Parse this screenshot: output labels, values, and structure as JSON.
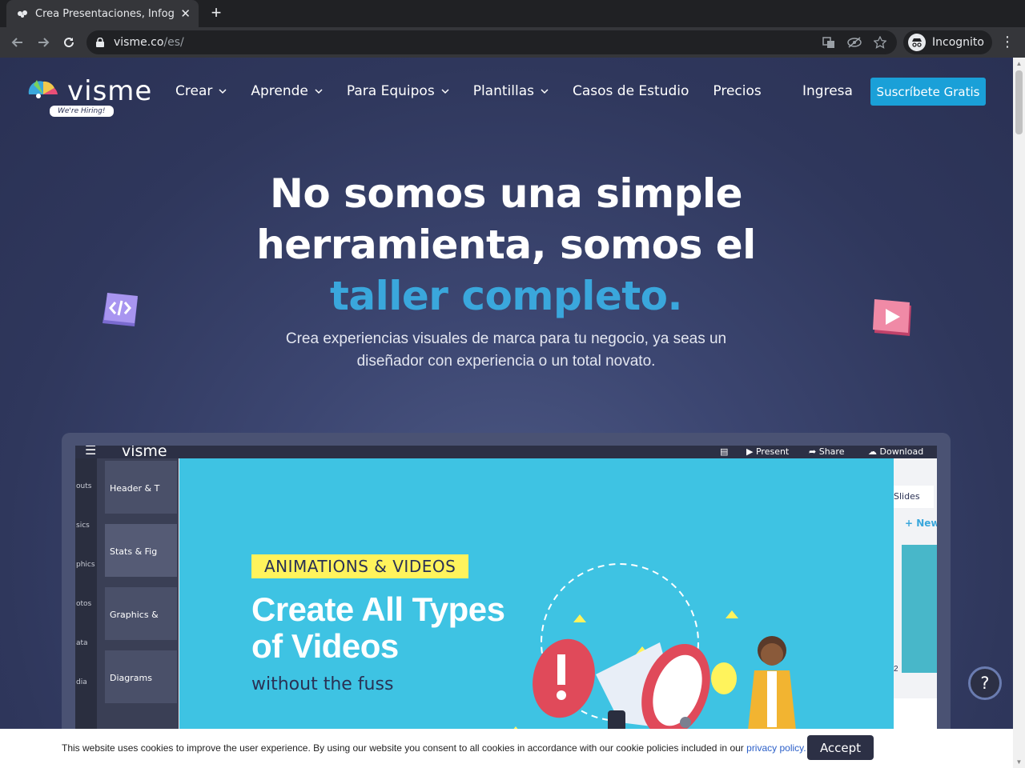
{
  "browser": {
    "tab_title": "Crea Presentaciones, Infog",
    "tab_close": "✕",
    "new_tab": "+",
    "url_host": "visme.co",
    "url_path": "/es/",
    "profile_label": "Incognito",
    "menu": "⋮"
  },
  "header": {
    "logo_text": "visme",
    "hiring_badge": "We're Hiring!",
    "nav": [
      {
        "label": "Crear",
        "has_dropdown": true
      },
      {
        "label": "Aprende",
        "has_dropdown": true
      },
      {
        "label": "Para Equipos",
        "has_dropdown": true
      },
      {
        "label": "Plantillas",
        "has_dropdown": true
      },
      {
        "label": "Casos de Estudio",
        "has_dropdown": false
      },
      {
        "label": "Precios",
        "has_dropdown": false
      }
    ],
    "login": "Ingresa",
    "signup": "Suscríbete Gratis"
  },
  "hero": {
    "title_line1": "No somos una simple",
    "title_line2": "herramienta, somos el",
    "title_accent": "taller completo.",
    "subtitle": "Crea experiencias visuales de marca para tu negocio, ya seas un diseñador con experiencia o un total novato."
  },
  "mockup": {
    "logo_text": "visme",
    "present": "Present",
    "share": "Share",
    "download": "Download",
    "side_labels": [
      "outs",
      "sics",
      "phics",
      "otos",
      "ata",
      "dia"
    ],
    "panel_cards": [
      "Header & T",
      "Stats & Fig",
      "Graphics &",
      "Diagrams"
    ],
    "tag": "ANIMATIONS & VIDEOS",
    "big_title": "Create All Types of Videos",
    "sub": "without the fuss",
    "slides_label": "Slides",
    "new_label": "+ New",
    "slide_number": "2"
  },
  "cookie": {
    "text": "This website uses cookies to improve the user experience. By using our website you consent to all cookies in accordance with our cookie policies included in our",
    "link": "privacy policy.",
    "accept": "Accept"
  },
  "help_label": "?",
  "colors": {
    "accent": "#3aa7dc",
    "signup_bg": "#1aa0d8",
    "hero_bg": "#2f375c",
    "canvas_bg": "#3ec3e3",
    "tag_bg": "#fff35c"
  }
}
